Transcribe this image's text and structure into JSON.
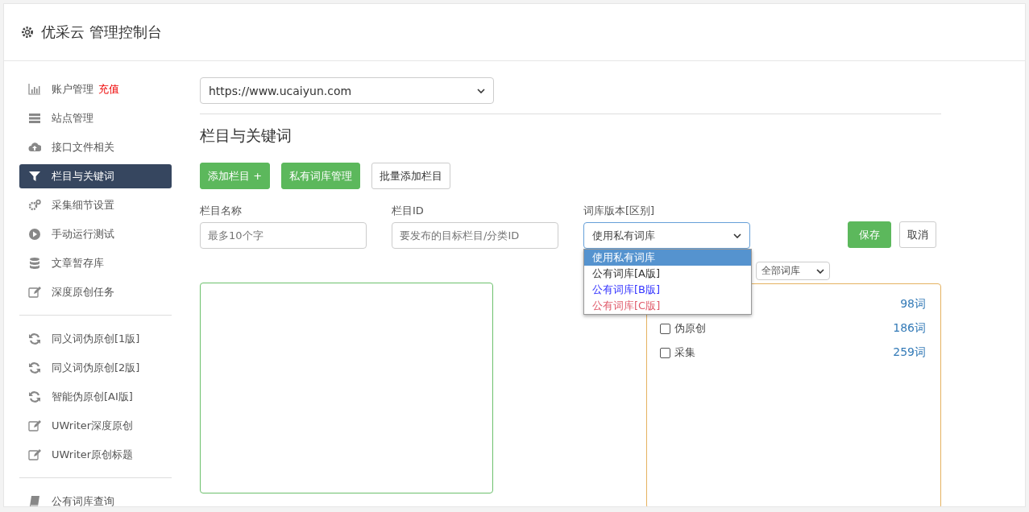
{
  "header": {
    "title": "优采云 管理控制台"
  },
  "sidebar": {
    "groups": [
      {
        "items": [
          {
            "kind": "bar-chart",
            "label": "账户管理",
            "badge": "充值",
            "selected": false
          },
          {
            "kind": "server",
            "label": "站点管理",
            "selected": false
          },
          {
            "kind": "cloud-upload",
            "label": "接口文件相关",
            "selected": false
          },
          {
            "kind": "filter",
            "label": "栏目与关键词",
            "selected": true
          },
          {
            "kind": "gears",
            "label": "采集细节设置",
            "selected": false
          },
          {
            "kind": "play",
            "label": "手动运行测试",
            "selected": false
          },
          {
            "kind": "database",
            "label": "文章暂存库",
            "selected": false
          },
          {
            "kind": "edit",
            "label": "深度原创任务",
            "selected": false
          }
        ]
      },
      {
        "items": [
          {
            "kind": "refresh",
            "label": "同义词伪原创[1版]",
            "selected": false
          },
          {
            "kind": "refresh",
            "label": "同义词伪原创[2版]",
            "selected": false
          },
          {
            "kind": "refresh",
            "label": "智能伪原创[AI版]",
            "selected": false
          },
          {
            "kind": "edit",
            "label": "UWriter深度原创",
            "selected": false
          },
          {
            "kind": "edit",
            "label": "UWriter原创标题",
            "selected": false
          }
        ]
      },
      {
        "items": [
          {
            "kind": "book",
            "label": "公有词库查询",
            "selected": false
          }
        ]
      }
    ]
  },
  "site_select": {
    "value": "https://www.ucaiyun.com"
  },
  "section_title": "栏目与关键词",
  "toolbar": [
    {
      "label": "添加栏目 +",
      "kind": "primary"
    },
    {
      "label": "私有词库管理",
      "kind": "primary"
    },
    {
      "label": "批量添加栏目",
      "kind": "default"
    }
  ],
  "form": {
    "fields": [
      {
        "label": "栏目名称",
        "placeholder": "最多10个字"
      },
      {
        "label": "栏目ID",
        "placeholder": "要发布的目标栏目/分类ID"
      }
    ],
    "library_select": {
      "label": "词库版本[区别]",
      "value": "使用私有词库",
      "expanded": true,
      "options": [
        {
          "label": "使用私有词库",
          "selected": true
        },
        {
          "label": "公有词库[A版]",
          "selected": false,
          "color": "#333333"
        },
        {
          "label": "公有词库[B版]",
          "selected": false,
          "color": "#3333ff"
        },
        {
          "label": "公有词库[C版]",
          "selected": false,
          "color": "#e05a6a"
        }
      ]
    },
    "buttons": [
      {
        "label": "保存",
        "kind": "primary"
      },
      {
        "label": "取消",
        "kind": "default"
      }
    ]
  },
  "filter_select": {
    "value": "全部词库"
  },
  "library_list": [
    {
      "count": "98词"
    },
    {
      "label": "伪原创",
      "count": "186词",
      "checked": false
    },
    {
      "label": "采集",
      "count": "259词",
      "checked": false
    }
  ]
}
